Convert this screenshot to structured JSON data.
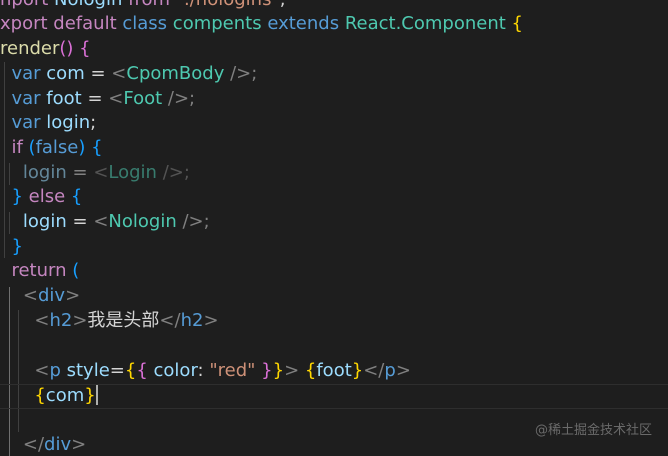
{
  "editor": {
    "line1": {
      "kw": "nport",
      "name": "Nologin",
      "from": "from",
      "src": "\"./nologins\"",
      "semi": ";"
    },
    "line2": {
      "export": "xport",
      "default": "default",
      "class": "class",
      "name": "compents",
      "extends": "extends",
      "base": "React.Component",
      "brace": "{"
    },
    "line3": {
      "fn": "render",
      "parens": "()",
      "brace": "{"
    },
    "line4": {
      "kw": "var",
      "name": "com",
      "eq": "=",
      "open": "<",
      "tag": "CpomBody",
      "close": "/>;"
    },
    "line5": {
      "kw": "var",
      "name": "foot",
      "eq": "=",
      "open": "<",
      "tag": "Foot",
      "close": "/>;"
    },
    "line6": {
      "kw": "var",
      "name": "login",
      "semi": ";"
    },
    "line7": {
      "kw": "if",
      "open": "(",
      "cond": "false",
      "close": ")",
      "brace": "{"
    },
    "line8": {
      "name": "login",
      "eq": "=",
      "open": "<",
      "tag": "Login",
      "close": "/>;"
    },
    "line9": {
      "close_brace": "}",
      "kw": "else",
      "brace": "{"
    },
    "line10": {
      "name": "login",
      "eq": "=",
      "open": "<",
      "tag": "Nologin",
      "close": "/>;"
    },
    "line11": {
      "brace": "}"
    },
    "line12": {
      "kw": "return",
      "paren": "("
    },
    "line13": {
      "open": "<",
      "tag": "div",
      "close": ">"
    },
    "line14": {
      "open": "<",
      "tag": "h2",
      "close": ">",
      "text": "我是头部",
      "end_open": "</",
      "end_tag": "h2",
      "end_close": ">"
    },
    "line15": {},
    "line16": {
      "open": "<",
      "tag": "p",
      "attr": "style",
      "eq": "=",
      "ob1": "{",
      "ob2": "{",
      "prop": "color",
      "colon": ":",
      "val": "\"red\"",
      "cb2": "}",
      "cb1": "}",
      "close": ">",
      "expr_open": "{",
      "expr": "foot",
      "expr_close": "}",
      "end_open": "</",
      "end_tag": "p",
      "end_close": ">"
    },
    "line17": {
      "open": "{",
      "expr": "com",
      "close": "}"
    },
    "line18": {},
    "line19": {
      "open": "</",
      "tag": "div",
      "close": ">"
    }
  },
  "watermark": "@稀土掘金技术社区",
  "colors": {
    "background": "#1e1e1e",
    "keyword": "#569cd6",
    "control": "#c586c0",
    "variable": "#9cdcfe",
    "function": "#dcdcaa",
    "class": "#4ec9b0",
    "string": "#ce9178",
    "bracket_gold": "#ffd700",
    "bracket_orchid": "#da70d6",
    "bracket_blue": "#179fff"
  }
}
